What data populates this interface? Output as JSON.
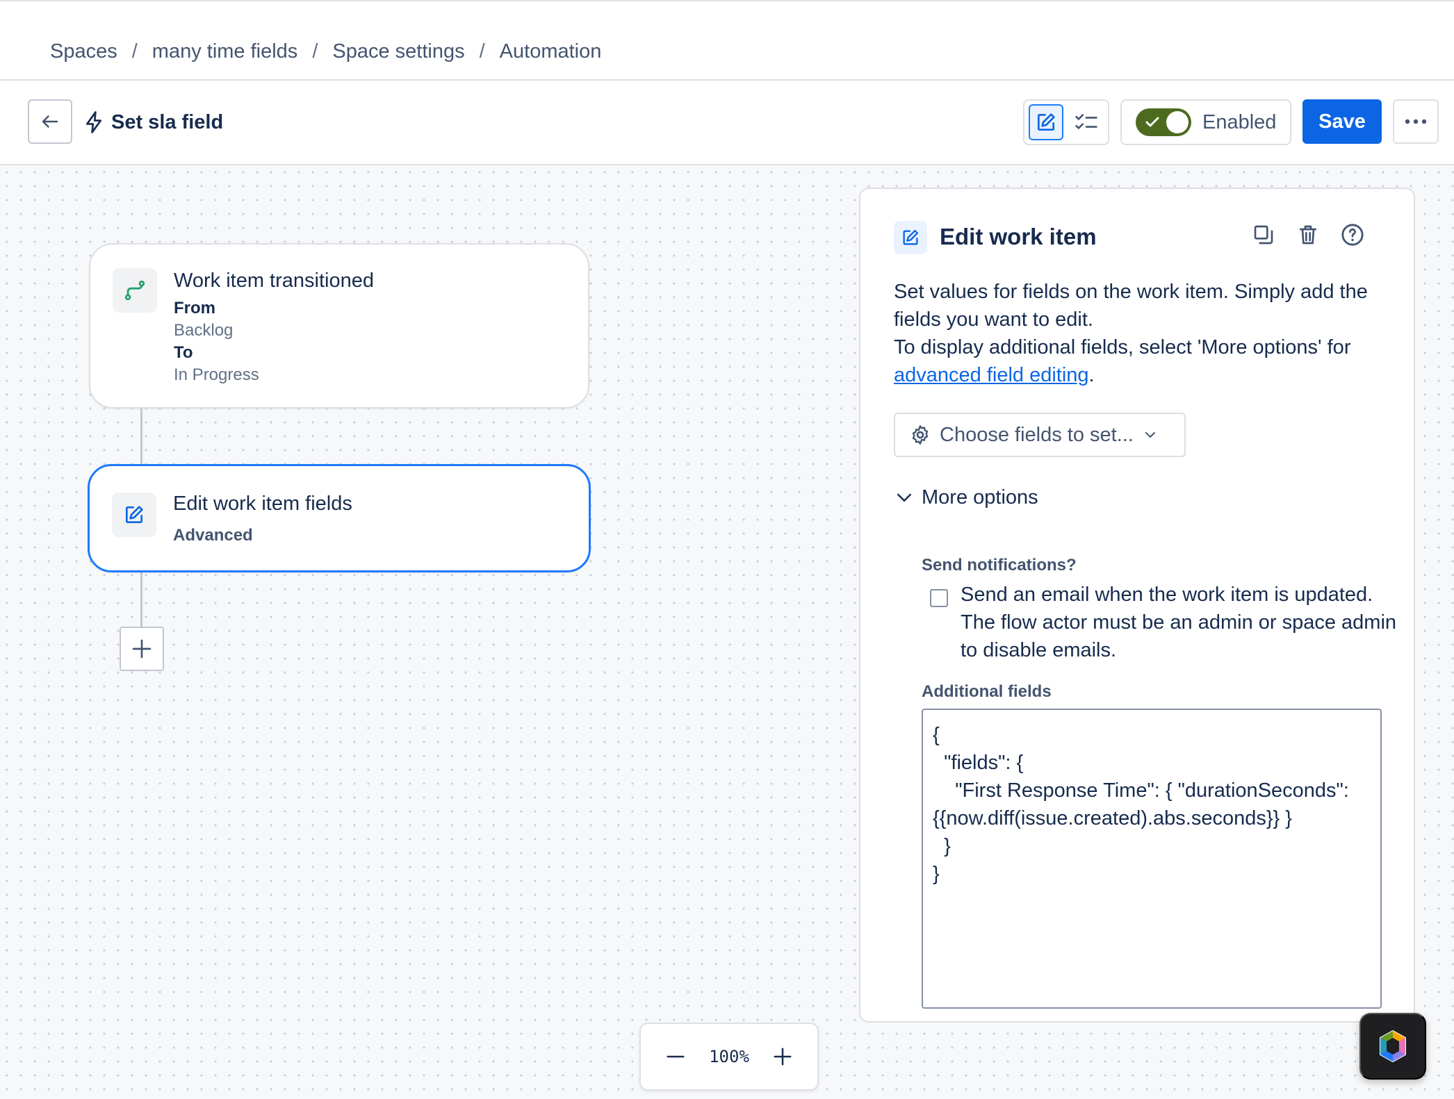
{
  "breadcrumb": {
    "items": [
      "Spaces",
      "many time fields",
      "Space settings",
      "Automation"
    ],
    "separator": "/"
  },
  "header": {
    "title": "Set sla field",
    "enabled_label": "Enabled",
    "enabled": true,
    "save_label": "Save"
  },
  "flow": {
    "trigger": {
      "title": "Work item transitioned",
      "from_label": "From",
      "from_value": "Backlog",
      "to_label": "To",
      "to_value": "In Progress"
    },
    "action": {
      "title": "Edit work item fields",
      "subtitle": "Advanced"
    }
  },
  "panel": {
    "title": "Edit work item",
    "desc_line1": "Set values for fields on the work item. Simply add the fields you want to edit.",
    "desc_line2": "To display additional fields, select 'More options' for",
    "desc_link": "advanced field editing",
    "desc_end": ".",
    "choose_label": "Choose fields to set...",
    "more_options_label": "More options",
    "notifications_label": "Send notifications?",
    "notifications_text": "Send an email when the work item is updated. The flow actor must be an admin or space admin to disable emails.",
    "notifications_checked": false,
    "additional_fields_label": "Additional fields",
    "additional_fields_value": "{\n  \"fields\": {\n    \"First Response Time\": { \"durationSeconds\":\n{{now.diff(issue.created).abs.seconds}} }\n  }\n}"
  },
  "zoom": {
    "level": "100%"
  },
  "colors": {
    "primary": "#0c66e4",
    "toggle_on": "#4c6b1f",
    "selected_border": "#1d7afc",
    "trigger_icon": "#22a06b"
  },
  "icons": [
    "back-arrow-icon",
    "lightning-icon",
    "edit-pencil-icon",
    "checklist-icon",
    "checkmark-icon",
    "more-dots-icon",
    "transition-icon",
    "duplicate-icon",
    "trash-icon",
    "help-icon",
    "gear-icon",
    "chevron-down-icon",
    "plus-icon",
    "minus-icon",
    "rovo-icon"
  ]
}
